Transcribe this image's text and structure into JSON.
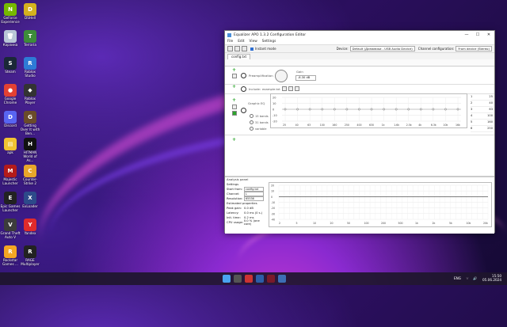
{
  "desktop_icons": [
    {
      "label": "GeForce Experience",
      "color": "#76b900",
      "glyph": "N",
      "icon": "nvidia-icon"
    },
    {
      "label": "DSHell",
      "color": "#d4b21f",
      "glyph": "D",
      "icon": "dshell-icon"
    },
    {
      "label": "Корзина",
      "color": "#b8c6d6",
      "glyph": "🗑",
      "icon": "recycle-bin-icon"
    },
    {
      "label": "Terraria",
      "color": "#3d8c3a",
      "glyph": "T",
      "icon": "terraria-icon"
    },
    {
      "label": "Steam",
      "color": "#1b2838",
      "glyph": "S",
      "icon": "steam-icon"
    },
    {
      "label": "Roblox Studio",
      "color": "#2e7bd6",
      "glyph": "R",
      "icon": "roblox-studio-icon"
    },
    {
      "label": "Google Chrome",
      "color": "#e34133",
      "glyph": "●",
      "icon": "chrome-icon"
    },
    {
      "label": "Roblox Player",
      "color": "#333",
      "glyph": "◆",
      "icon": "roblox-icon"
    },
    {
      "label": "Discord",
      "color": "#5865f2",
      "glyph": "D",
      "icon": "discord-icon"
    },
    {
      "label": "Getting Over It with Ben...",
      "color": "#6a4b2a",
      "glyph": "G",
      "icon": "getting-over-it-icon"
    },
    {
      "label": "apk",
      "color": "#f1c232",
      "glyph": "▤",
      "icon": "folder-icon"
    },
    {
      "label": "HITMAN World of As...",
      "color": "#111",
      "glyph": "H",
      "icon": "hitman-icon"
    },
    {
      "label": "Majestic Launcher",
      "color": "#b31b1b",
      "glyph": "M",
      "icon": "majestic-icon"
    },
    {
      "label": "Counter-Strike 2",
      "color": "#e8a62a",
      "glyph": "C",
      "icon": "cs2-icon"
    },
    {
      "label": "Epic Games Launcher",
      "color": "#222",
      "glyph": "E",
      "icon": "epic-icon"
    },
    {
      "label": "ExLoader",
      "color": "#2d4a8a",
      "glyph": "X",
      "icon": "exloader-icon"
    },
    {
      "label": "Grand Theft Auto V",
      "color": "#3c3c3c",
      "glyph": "V",
      "icon": "gta-icon"
    },
    {
      "label": "Yandex",
      "color": "#e02b2b",
      "glyph": "Y",
      "icon": "yandex-icon"
    },
    {
      "label": "Rockstar Games ...",
      "color": "#f5a623",
      "glyph": "R",
      "icon": "rockstar-icon"
    },
    {
      "label": "RAGE Multiplayer",
      "color": "#222",
      "glyph": "R",
      "icon": "rage-mp-icon"
    }
  ],
  "window": {
    "title": "Equalizer APO 1.3.2 Configuration Editor",
    "menu": [
      "File",
      "Edit",
      "View",
      "Settings"
    ],
    "instant_mode": "Instant mode",
    "device_label": "Device:",
    "device_value": "Default (Динамики - USB Audio Device)",
    "channel_label": "Channel configuration:",
    "channel_value": "From device (Stereo)",
    "tab": "config.txt",
    "preamp_label": "Preamplification",
    "gain_label": "Gain",
    "gain_value": "-8.30 dB",
    "include_label": "Include:",
    "include_value": "example.txt",
    "graphic_eq_label": "Graphic EQ",
    "radios": [
      "15 bands",
      "31 bands",
      "variable"
    ],
    "eq_y_ticks": [
      "20",
      "10",
      "0",
      "-10",
      "-20"
    ],
    "eq_freqs": [
      "25",
      "40",
      "63",
      "100",
      "160",
      "250",
      "400",
      "630",
      "1k",
      "1.6k",
      "2.5k",
      "4k",
      "6.3k",
      "10k",
      "16k"
    ],
    "eq_table": [
      [
        "1",
        "25"
      ],
      [
        "2",
        "40"
      ],
      [
        "3",
        "63"
      ],
      [
        "4",
        "100"
      ],
      [
        "5",
        "160"
      ],
      [
        "6",
        "250"
      ]
    ],
    "analysis_title": "Analysis panel",
    "settings_label": "Settings",
    "start_from_label": "Start from:",
    "start_from_value": "config.txt",
    "channel_sel_label": "Channel:",
    "channel_sel_value": "L",
    "resolution_label": "Resolution:",
    "resolution_value": "65536",
    "estimated_label": "Estimated properties",
    "peak_gain_label": "Peak gain:",
    "peak_gain_value": "0.0 dB",
    "latency_label": "Latency:",
    "latency_value": "0.0 ms (0 s.)",
    "init_time_label": "Init. time:",
    "init_time_value": "0.2 ms",
    "cpu_label": "CPU usage:",
    "cpu_value": "0.0 % (one core)",
    "an_y_ticks": [
      "20",
      "10",
      "0",
      "-10",
      "-20",
      "-30",
      "-40"
    ],
    "an_freqs": [
      "2",
      "5",
      "10",
      "20",
      "50",
      "100",
      "200",
      "500",
      "1k",
      "2k",
      "5k",
      "10k",
      "20k"
    ]
  },
  "taskbar": {
    "lang": "ENG",
    "time": "15:50",
    "date": "05.06.2024"
  }
}
